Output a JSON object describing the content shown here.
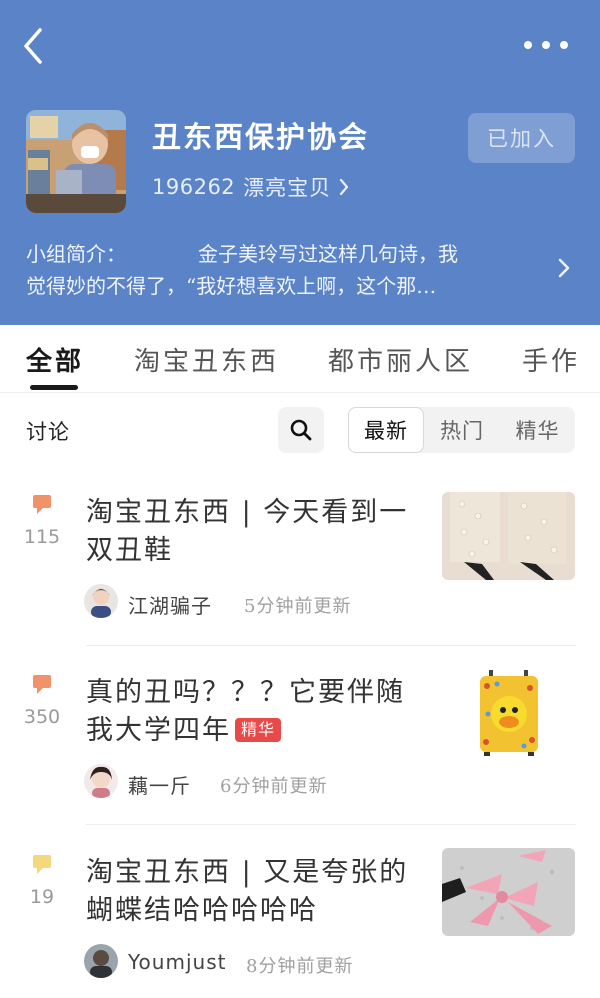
{
  "header": {
    "back_icon": "chevron-left-icon",
    "more_icon": "more-dots-icon",
    "group_name": "丑东西保护协会",
    "member_count": "196262",
    "member_label": "漂亮宝贝",
    "join_label": "已加入",
    "intro_label": "小组简介：",
    "intro_line1": "金子美玲写过这样几句诗，我",
    "intro_line2": "觉得妙的不得了，“我好想喜欢上啊，这个那…"
  },
  "tabs": [
    "全部",
    "淘宝丑东西",
    "都市丽人区",
    "手作"
  ],
  "filter": {
    "label": "讨论",
    "search_icon": "search-icon",
    "options": [
      "最新",
      "热门",
      "精华"
    ],
    "selected": "最新"
  },
  "posts": [
    {
      "comments": "115",
      "title": "淘宝丑东西 | 今天看到一双丑鞋",
      "badge": "",
      "user": "江湖骗子",
      "time": "5分钟前更新",
      "icon_color": "#f0926a"
    },
    {
      "comments": "350",
      "title": "真的丑吗？？？它要伴随我大学四年",
      "badge": "精华",
      "user": "藕一斤",
      "time": "6分钟前更新",
      "icon_color": "#f0926a"
    },
    {
      "comments": "19",
      "title": "淘宝丑东西 | 又是夸张的蝴蝶结哈哈哈哈哈",
      "badge": "",
      "user": "Youmjust",
      "time": "8分钟前更新",
      "icon_color": "#f5d77e"
    }
  ],
  "colors": {
    "header_bg": "#5b84c8",
    "badge_red": "#e84a4a"
  }
}
